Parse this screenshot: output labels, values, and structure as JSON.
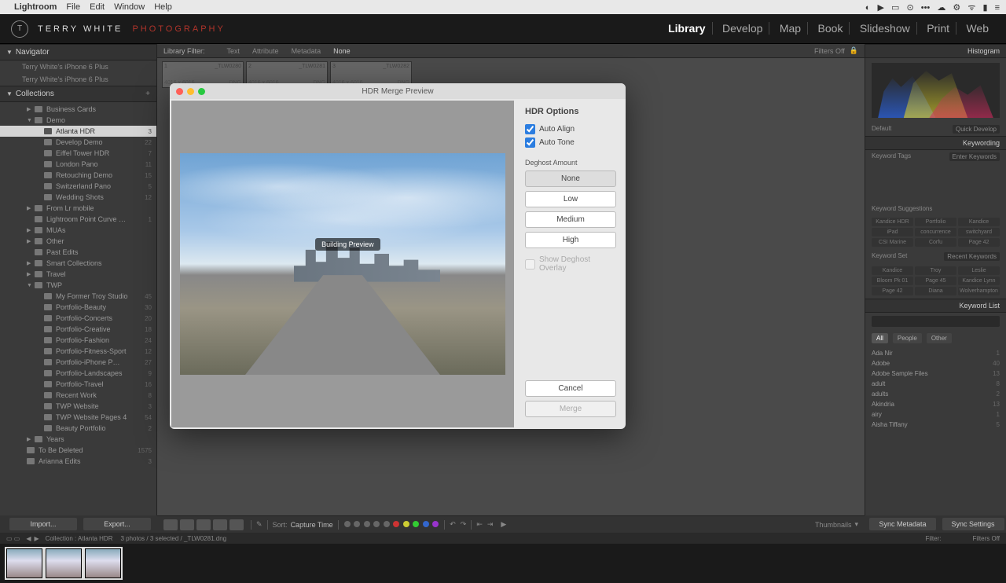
{
  "menubar": {
    "app": "Lightroom",
    "items": [
      "File",
      "Edit",
      "Window",
      "Help"
    ]
  },
  "brand": {
    "line1": "TERRY WHITE",
    "line2": "PHOTOGRAPHY"
  },
  "modules": [
    "Library",
    "Develop",
    "Map",
    "Book",
    "Slideshow",
    "Print",
    "Web"
  ],
  "active_module": "Library",
  "navigator": {
    "title": "Navigator",
    "rows": [
      "Terry White's iPhone 6 Plus",
      "Terry White's iPhone 6 Plus"
    ]
  },
  "collections": {
    "title": "Collections",
    "items": [
      {
        "label": "Business Cards",
        "level": 1,
        "arr": "▶"
      },
      {
        "label": "Demo",
        "level": 1,
        "arr": "▼"
      },
      {
        "label": "Atlanta HDR",
        "level": 2,
        "count": "3",
        "sel": true
      },
      {
        "label": "Develop Demo",
        "level": 2,
        "count": "22"
      },
      {
        "label": "Eiffel Tower HDR",
        "level": 2,
        "count": "7"
      },
      {
        "label": "London Pano",
        "level": 2,
        "count": "11"
      },
      {
        "label": "Retouching Demo",
        "level": 2,
        "count": "15"
      },
      {
        "label": "Switzerland Pano",
        "level": 2,
        "count": "5"
      },
      {
        "label": "Wedding Shots",
        "level": 2,
        "count": "12"
      },
      {
        "label": "From Lr mobile",
        "level": 1,
        "arr": "▶"
      },
      {
        "label": "Lightroom Point Curve …",
        "level": 1,
        "count": "1"
      },
      {
        "label": "MUAs",
        "level": 1,
        "arr": "▶"
      },
      {
        "label": "Other",
        "level": 1,
        "arr": "▶"
      },
      {
        "label": "Past Edits",
        "level": 1
      },
      {
        "label": "Smart Collections",
        "level": 1,
        "arr": "▶"
      },
      {
        "label": "Travel",
        "level": 1,
        "arr": "▶"
      },
      {
        "label": "TWP",
        "level": 1,
        "arr": "▼"
      },
      {
        "label": "My Former Troy Studio",
        "level": 2,
        "count": "45"
      },
      {
        "label": "Portfolio-Beauty",
        "level": 2,
        "count": "30"
      },
      {
        "label": "Portfolio-Concerts",
        "level": 2,
        "count": "20"
      },
      {
        "label": "Portfolio-Creative",
        "level": 2,
        "count": "18"
      },
      {
        "label": "Portfolio-Fashion",
        "level": 2,
        "count": "24"
      },
      {
        "label": "Portfolio-Fitness-Sport",
        "level": 2,
        "count": "12"
      },
      {
        "label": "Portfolio-iPhone P…",
        "level": 2,
        "count": "27"
      },
      {
        "label": "Portfolio-Landscapes",
        "level": 2,
        "count": "9"
      },
      {
        "label": "Portfolio-Travel",
        "level": 2,
        "count": "16"
      },
      {
        "label": "Recent Work",
        "level": 2,
        "count": "8"
      },
      {
        "label": "TWP Website",
        "level": 2,
        "count": "3"
      },
      {
        "label": "TWP Website Pages 4",
        "level": 2,
        "count": "54"
      },
      {
        "label": "Beauty Portfolio",
        "level": 2,
        "count": "2"
      },
      {
        "label": "Years",
        "level": 1,
        "arr": "▶"
      },
      {
        "label": "To Be Deleted",
        "level": 0,
        "count": "1575"
      },
      {
        "label": "Arianna Edits",
        "level": 0,
        "count": "3"
      }
    ]
  },
  "import_btn": "Import...",
  "export_btn": "Export...",
  "filterbar": {
    "label": "Library Filter:",
    "tabs": [
      "Text",
      "Attribute",
      "Metadata",
      "None"
    ],
    "active": "None",
    "right": "Filters Off"
  },
  "cells": [
    {
      "idx": "1",
      "name": "_TLW0280",
      "dim": "4016 x 6016",
      "fmt": "DNG"
    },
    {
      "idx": "2",
      "name": "_TLW0281",
      "dim": "4016 x 6016",
      "fmt": "DNG"
    },
    {
      "idx": "3",
      "name": "_TLW0282",
      "dim": "4016 x 6016",
      "fmt": "DNG"
    }
  ],
  "dialog": {
    "title": "HDR Merge Preview",
    "building": "Building Preview",
    "opts_title": "HDR Options",
    "auto_align": "Auto Align",
    "auto_tone": "Auto Tone",
    "deghost_label": "Deghost Amount",
    "levels": [
      "None",
      "Low",
      "Medium",
      "High"
    ],
    "selected": "None",
    "show_overlay": "Show Deghost Overlay",
    "cancel": "Cancel",
    "merge": "Merge"
  },
  "right": {
    "histogram": "Histogram",
    "quickdev": "Quick Develop",
    "default_lbl": "Default",
    "keywording": "Keywording",
    "kw_tags": "Keyword Tags",
    "kw_enter": "Enter Keywords",
    "kw_sugg": "Keyword Suggestions",
    "sugg": [
      "Kandice HDR",
      "Portfolio",
      "Kandice",
      "iPad",
      "concurrence",
      "switchyard",
      "CSI Marine",
      "Corfu",
      "Page 42"
    ],
    "kw_set": "Keyword Set",
    "kw_set_val": "Recent Keywords",
    "set": [
      "Kandice",
      "Troy",
      "Leslie",
      "Bloom Pk 01",
      "Page 45",
      "Kandice Lynn",
      "Page 42",
      "Diana",
      "Wolverhampton"
    ],
    "kw_list": "Keyword List",
    "filters": [
      "All",
      "People",
      "Other"
    ],
    "filter_on": "All",
    "list": [
      {
        "k": "Ada Nir",
        "n": "1"
      },
      {
        "k": "Adobe",
        "n": "40"
      },
      {
        "k": "Adobe Sample Files",
        "n": "13"
      },
      {
        "k": "adult",
        "n": "8"
      },
      {
        "k": "adults",
        "n": "2"
      },
      {
        "k": "Akindria",
        "n": "13"
      },
      {
        "k": "airy",
        "n": "1"
      },
      {
        "k": "Aisha Tiffany",
        "n": "5"
      }
    ],
    "sync_meta": "Sync Metadata",
    "sync_set": "Sync Settings"
  },
  "toolbar": {
    "sort": "Sort:",
    "sort_val": "Capture Time",
    "thumbs": "Thumbnails"
  },
  "status": {
    "coll": "Collection : Atlanta HDR",
    "count": "3 photos / 3 selected / _TLW0281.dng",
    "filter": "Filter:",
    "filters_off": "Filters Off"
  }
}
